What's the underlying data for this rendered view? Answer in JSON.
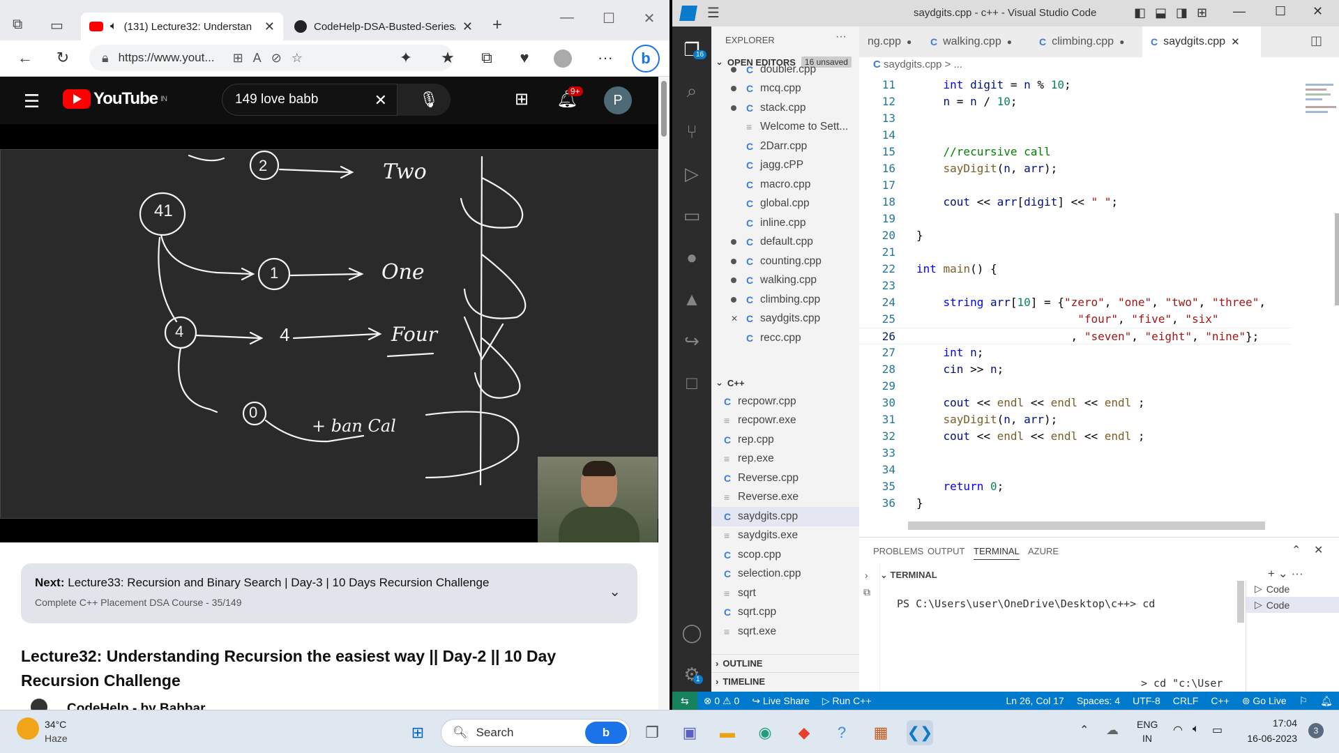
{
  "edge": {
    "tabs": [
      {
        "title": "(131) Lecture32: Understan",
        "icon": "youtube-icon"
      },
      {
        "title": "CodeHelp-DSA-Busted-Series/l",
        "icon": "github-icon"
      }
    ],
    "url": "https://www.yout...",
    "youtube": {
      "logo_text": "YouTube",
      "region": "IN",
      "search_value": "149 love babb",
      "notif_count": "9+",
      "avatar_letter": "P",
      "next_label": "Next:",
      "next_title": "Lecture33: Recursion and Binary Search | Day-3 | 10 Days Recursion Challenge",
      "next_sub": "Complete C++ Placement DSA Course - 35/149",
      "video_title": "Lecture32: Understanding Recursion the easiest way || Day-2 || 10 Day Recursion Challenge",
      "channel": "CodeHelp - by Babbar"
    },
    "board_text": [
      "2",
      "Two",
      "41",
      "1",
      "One",
      "4",
      "4",
      "Four",
      "0",
      "+ ban Cal"
    ]
  },
  "vscode": {
    "title": "saydgits.cpp - c++ - Visual Studio Code",
    "explorer_label": "EXPLORER",
    "open_editors_label": "OPEN EDITORS",
    "unsaved": "16 unsaved",
    "activity_badge": "16",
    "settings_badge": "1",
    "open_editors": [
      {
        "name": "doubler.cpp",
        "dot": true,
        "type": "cpp"
      },
      {
        "name": "mcq.cpp",
        "dot": true,
        "type": "cpp"
      },
      {
        "name": "stack.cpp",
        "dot": true,
        "type": "cpp"
      },
      {
        "name": "Welcome to Sett...",
        "dot": false,
        "type": "file"
      },
      {
        "name": "2Darr.cpp",
        "dot": false,
        "type": "cpp"
      },
      {
        "name": "jagg.cPP",
        "dot": false,
        "type": "cpp"
      },
      {
        "name": "macro.cpp",
        "dot": false,
        "type": "cpp"
      },
      {
        "name": "global.cpp",
        "dot": false,
        "type": "cpp"
      },
      {
        "name": "inline.cpp",
        "dot": false,
        "type": "cpp"
      },
      {
        "name": "default.cpp",
        "dot": true,
        "type": "cpp"
      },
      {
        "name": "counting.cpp",
        "dot": true,
        "type": "cpp"
      },
      {
        "name": "walking.cpp",
        "dot": true,
        "type": "cpp"
      },
      {
        "name": "climbing.cpp",
        "dot": true,
        "type": "cpp"
      },
      {
        "name": "saydgits.cpp",
        "dot": false,
        "close": true,
        "type": "cpp"
      },
      {
        "name": "recc.cpp",
        "dot": false,
        "type": "cpp"
      },
      {
        "name": "recpowr.cpp",
        "dot": false,
        "type": "cpp"
      }
    ],
    "folder_label": "C++",
    "folder_files": [
      {
        "name": "recpowr.cpp",
        "type": "cpp"
      },
      {
        "name": "recpowr.exe",
        "type": "file"
      },
      {
        "name": "rep.cpp",
        "type": "cpp"
      },
      {
        "name": "rep.exe",
        "type": "file"
      },
      {
        "name": "Reverse.cpp",
        "type": "cpp"
      },
      {
        "name": "Reverse.exe",
        "type": "file"
      },
      {
        "name": "saydgits.cpp",
        "type": "cpp",
        "selected": true
      },
      {
        "name": "saydgits.exe",
        "type": "file"
      },
      {
        "name": "scop.cpp",
        "type": "cpp"
      },
      {
        "name": "selection.cpp",
        "type": "cpp"
      },
      {
        "name": "sqrt",
        "type": "file"
      },
      {
        "name": "sqrt.cpp",
        "type": "cpp"
      },
      {
        "name": "sqrt.exe",
        "type": "file"
      }
    ],
    "outline_label": "OUTLINE",
    "timeline_label": "TIMELINE",
    "editor_tabs": [
      {
        "name": "ng.cpp",
        "dot": true
      },
      {
        "name": "walking.cpp",
        "dot": true
      },
      {
        "name": "climbing.cpp",
        "dot": true
      },
      {
        "name": "saydgits.cpp",
        "active": true
      }
    ],
    "breadcrumb": "saydgits.cpp > ...",
    "code_lines": [
      {
        "n": "11",
        "html": "    <span class='kw'>int</span> <span class='var'>digit</span> = <span class='var'>n</span> % <span class='num'>10</span>;"
      },
      {
        "n": "12",
        "html": "    <span class='var'>n</span> = <span class='var'>n</span> / <span class='num'>10</span>;"
      },
      {
        "n": "13",
        "html": ""
      },
      {
        "n": "14",
        "html": ""
      },
      {
        "n": "15",
        "html": "    <span class='cm'>//recursive call</span>"
      },
      {
        "n": "16",
        "html": "    <span class='fn'>sayDigit</span>(<span class='var'>n</span>, <span class='var'>arr</span>);"
      },
      {
        "n": "17",
        "html": ""
      },
      {
        "n": "18",
        "html": "    <span class='var'>cout</span> &lt;&lt; <span class='var'>arr</span>[<span class='var'>digit</span>] &lt;&lt; <span class='str'>\" \"</span>;"
      },
      {
        "n": "19",
        "html": ""
      },
      {
        "n": "20",
        "html": "}"
      },
      {
        "n": "21",
        "html": ""
      },
      {
        "n": "22",
        "html": "<span class='kw'>int</span> <span class='fn'>main</span>() {"
      },
      {
        "n": "23",
        "html": ""
      },
      {
        "n": "24",
        "html": "    <span class='kw'>string</span> <span class='var'>arr</span>[<span class='num'>10</span>] = {<span class='str'>\"zero\"</span>, <span class='str'>\"one\"</span>, <span class='str'>\"two\"</span>, <span class='str'>\"three\"</span>,"
      },
      {
        "n": "25",
        "html": "                        <span class='str'>\"four\"</span>, <span class='str'>\"five\"</span>, <span class='str'>\"six\"</span>"
      },
      {
        "n": "26",
        "html": "                       , <span class='str'>\"seven\"</span>, <span class='str'>\"eight\"</span>, <span class='str'>\"nine\"</span>};",
        "current": true
      },
      {
        "n": "27",
        "html": "    <span class='kw'>int</span> <span class='var'>n</span>;"
      },
      {
        "n": "28",
        "html": "    <span class='var'>cin</span> &gt;&gt; <span class='var'>n</span>;"
      },
      {
        "n": "29",
        "html": ""
      },
      {
        "n": "30",
        "html": "    <span class='var'>cout</span> &lt;&lt; <span class='fn'>endl</span> &lt;&lt; <span class='fn'>endl</span> &lt;&lt; <span class='fn'>endl</span> ;"
      },
      {
        "n": "31",
        "html": "    <span class='fn'>sayDigit</span>(<span class='var'>n</span>, <span class='var'>arr</span>);"
      },
      {
        "n": "32",
        "html": "    <span class='var'>cout</span> &lt;&lt; <span class='fn'>endl</span> &lt;&lt; <span class='fn'>endl</span> &lt;&lt; <span class='fn'>endl</span> ;"
      },
      {
        "n": "33",
        "html": ""
      },
      {
        "n": "34",
        "html": ""
      },
      {
        "n": "35",
        "html": "    <span class='kw'>return</span> <span class='num'>0</span>;"
      },
      {
        "n": "36",
        "html": "}"
      }
    ],
    "panel_tabs": [
      "PROBLEMS",
      "OUTPUT",
      "TERMINAL",
      "AZURE"
    ],
    "terminal_label": "TERMINAL",
    "terminal_prompt": "PS C:\\Users\\user\\OneDrive\\Desktop\\c++> cd",
    "terminal_tail": "> cd \"c:\\User",
    "terminal_sessions": [
      "Code",
      "Code"
    ],
    "status": {
      "errors": "0",
      "warnings": "0",
      "liveshare": "Live Share",
      "run": "Run C++",
      "position": "Ln 26, Col 17",
      "spaces": "Spaces: 4",
      "encoding": "UTF-8",
      "eol": "CRLF",
      "lang": "C++",
      "golive": "Go Live"
    }
  },
  "taskbar": {
    "temp": "34°C",
    "weather": "Haze",
    "search_placeholder": "Search",
    "lang1": "ENG",
    "lang2": "IN",
    "time": "17:04",
    "date": "16-06-2023",
    "notif": "3"
  }
}
